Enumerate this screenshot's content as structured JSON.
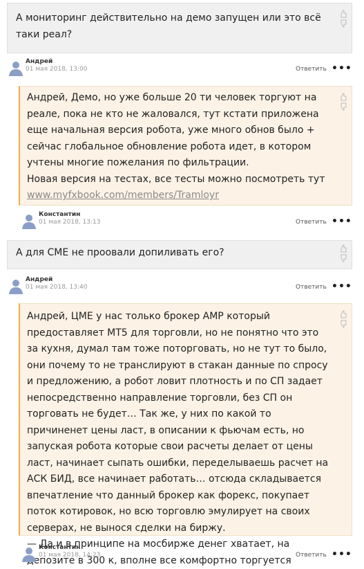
{
  "comments": [
    {
      "kind": "question",
      "text": "А мониторинг действительно на демо запущен или это всё таки реал?",
      "author": "Андрей",
      "date": "01 мая 2018, 13:00",
      "reply_label": "Ответить",
      "more_label": "•••"
    },
    {
      "kind": "reply",
      "text": "Андрей, Демо, но уже больше 20 ти человек торгуют на реале, пока не кто не жаловался, тут кстати приложена еще начальная версия робота, уже много обнов было + сейчас глобальное обновление робота идет, в котором учтены многие пожелания по фильтрации.\nНовая версия на тестах, все тесты можно посмотреть тут",
      "link": "www.myfxbook.com/members/Tramloyr",
      "author": "Константин",
      "date": "01 мая 2018, 13:13",
      "reply_label": "Ответить",
      "more_label": "•••"
    },
    {
      "kind": "question",
      "text": "А для CME не проовали допиливать его?",
      "author": "Андрей",
      "date": "01 мая 2018, 13:40",
      "reply_label": "Ответить",
      "more_label": "•••"
    },
    {
      "kind": "reply",
      "text": "Андрей, ЦМЕ у нас только брокер AMP который предоставляет MT5 для торговли, но не понятно что это за кухня, думал там тоже поторговать, но не тут то было, они почему то не транслируют в стакан данные по спросу и предложению, а робот ловит плотность и по СП задает непосредственно направление торговли, без СП он торговать не будет… Так же, у них по какой то причиненет цены ласт, в описании к фьючам есть, но запуская робота которые свои расчеты делает от цены ласт, начинает сыпать ошибки, переделываешь расчет на АСК БИД, все начинает работать… отсюда складывается впечатление что данный брокер как форекс, покупает поток котировок, но всю торговлю эмулирует на своих серверах, не вынося сделки на биржу.\n— Да и в принципе на мосбирже денег хватает, на депозите в 300 к, вполне все комфортно торгуется",
      "author": "Константин",
      "date": "01 мая 2018, 14:23",
      "reply_label": "Ответить",
      "more_label": "•••"
    }
  ],
  "icons": {
    "vote_up": "thumb-up-icon",
    "vote_down": "thumb-down-icon",
    "avatar": "user-avatar-icon"
  },
  "colors": {
    "question_bg": "#f0f0f0",
    "reply_bg": "#fcf2e6",
    "reply_accent": "#f0ab4e",
    "link": "#8a8a8a",
    "date": "#999999",
    "avatar": "#8a9fc8"
  }
}
